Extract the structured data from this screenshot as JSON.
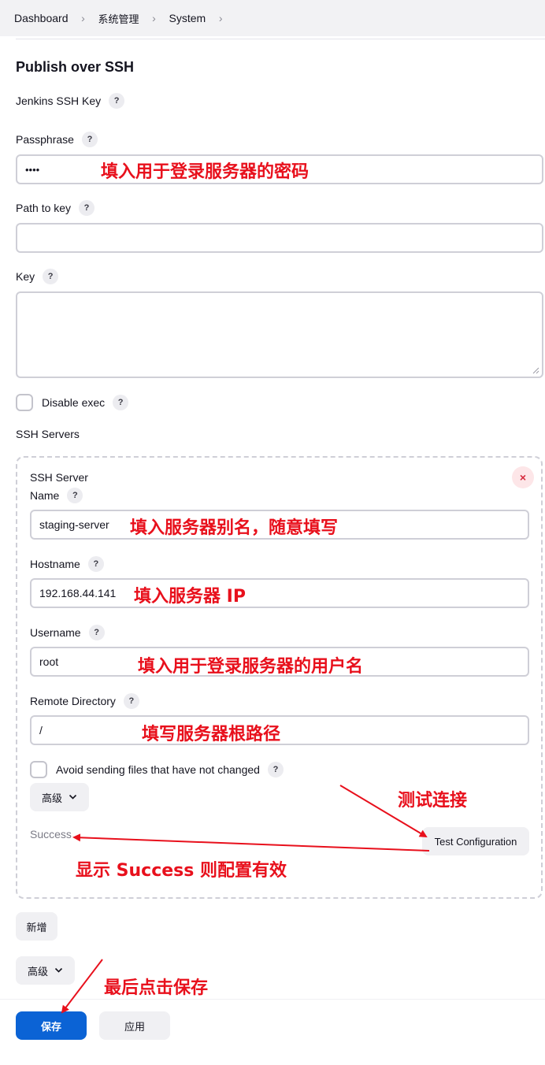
{
  "breadcrumb": {
    "items": [
      "Dashboard",
      "系统管理",
      "System"
    ]
  },
  "section": {
    "title": "Publish over SSH"
  },
  "help_glyph": "?",
  "fields": {
    "jenkins_ssh_key_label": "Jenkins SSH Key",
    "passphrase_label": "Passphrase",
    "passphrase_value": "••••",
    "path_to_key_label": "Path to key",
    "path_to_key_value": "",
    "key_label": "Key",
    "key_value": "",
    "disable_exec_label": "Disable exec",
    "disable_exec_checked": false,
    "ssh_servers_label": "SSH Servers"
  },
  "server": {
    "heading": "SSH Server",
    "close_glyph": "×",
    "name_label": "Name",
    "name_value": "staging-server",
    "hostname_label": "Hostname",
    "hostname_value": "192.168.44.141",
    "username_label": "Username",
    "username_value": "root",
    "remote_dir_label": "Remote Directory",
    "remote_dir_value": "/",
    "avoid_sending_label": "Avoid sending files that have not changed",
    "avoid_sending_checked": false,
    "advanced_label": "高级",
    "status_text": "Success",
    "test_button_label": "Test Configuration"
  },
  "add_button_label": "新增",
  "advanced_button_label": "高级",
  "footer": {
    "save_label": "保存",
    "apply_label": "应用"
  },
  "annotations": {
    "passphrase": "填入用于登录服务器的密码",
    "name": "填入服务器别名，随意填写",
    "hostname": "填入服务器 IP",
    "username": "填入用于登录服务器的用户名",
    "remote_dir": "填写服务器根路径",
    "test": "测试连接",
    "success": "显示 Success 则配置有效",
    "save": "最后点击保存"
  },
  "colors": {
    "accent": "#0b63d5",
    "annotation": "#e8101c",
    "close": "#d6283b"
  }
}
